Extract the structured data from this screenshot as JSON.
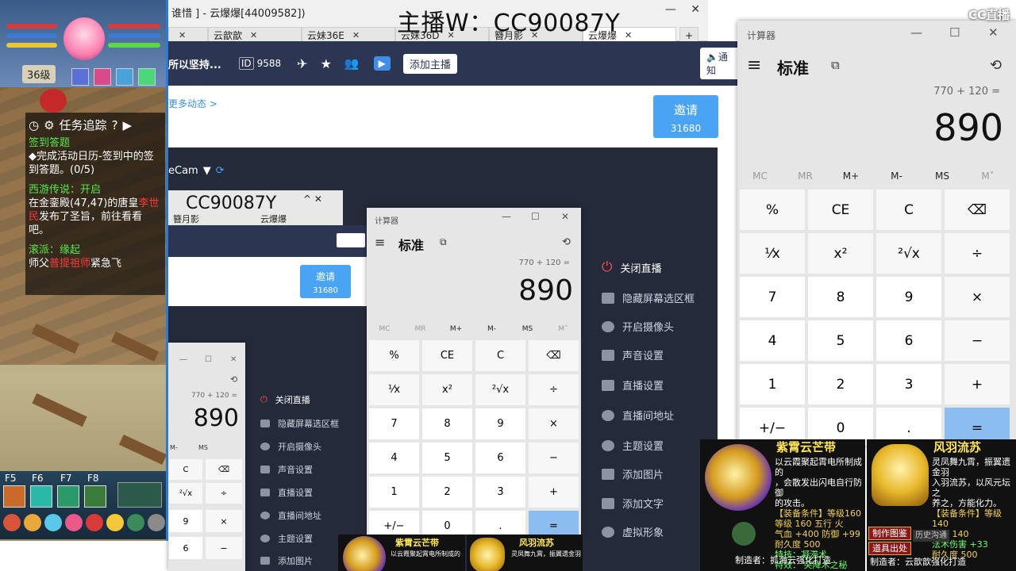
{
  "watermark": "主播W：CC90087Y",
  "cc_logo": "CC直播",
  "browser": {
    "title": "谁惜 ] - 云爆爆[44009582])",
    "tabs": [
      {
        "label": "云歆歆"
      },
      {
        "label": "云妹36E"
      },
      {
        "label": "云妹36D"
      },
      {
        "label": "簪月影"
      },
      {
        "label": "云爆爆"
      }
    ],
    "new_tab": "+"
  },
  "cc_toolbar": {
    "slogan": "所以坚持...",
    "id_label": "ID",
    "id_value": "9588",
    "add_anchor": "添加主播",
    "notify": "通知",
    "dynamic_link": "更多动态 >",
    "invite_label": "邀请",
    "invite_count": "31680",
    "source_label": "eCam"
  },
  "game": {
    "level": "36级",
    "task_tracking": "任务追踪",
    "tasks": [
      {
        "title": "签到答题",
        "body": "◆完成活动日历-签到中的签到答题。(0/5)"
      },
      {
        "title": "西游传说：开启",
        "body_a": "在金銮殿(47,47)的唐皇",
        "body_red": "李世民",
        "body_b": "发布了圣旨，前往看看吧。"
      },
      {
        "title": "滚派：缘起",
        "body_a": "师父",
        "body_red": "普提祖师",
        "body_b": "紧急飞"
      }
    ],
    "hotkeys": [
      "F5",
      "F6",
      "F7",
      "F8"
    ]
  },
  "stream_menu": [
    "关闭直播",
    "隐藏屏幕选区框",
    "开启摄像头",
    "声音设置",
    "直播设置",
    "直播间地址",
    "主题设置",
    "添加图片",
    "添加文字",
    "虚拟形象"
  ],
  "calculator": {
    "app_name": "计算器",
    "mode": "标准",
    "expression": "770 + 120 =",
    "result": "890",
    "memory": [
      "MC",
      "MR",
      "M+",
      "M-",
      "MS",
      "M˅"
    ],
    "keys": [
      [
        "%",
        "CE",
        "C",
        "⌫"
      ],
      [
        "¹⁄x",
        "x²",
        "²√x",
        "÷"
      ],
      [
        "7",
        "8",
        "9",
        "×"
      ],
      [
        "4",
        "5",
        "6",
        "−"
      ],
      [
        "1",
        "2",
        "3",
        "+"
      ],
      [
        "+/−",
        "0",
        ".",
        "="
      ]
    ]
  },
  "items": [
    {
      "name": "紫霄云芒带",
      "line1": "以云霞聚起霄电所制成的",
      "line2": "，会散发出闪电自行防御",
      "line3": "的攻击。",
      "req": "【装备条件】等级160",
      "stats_a": "等级 160  五行 火",
      "stats_b": "气血 +400 防御 +99",
      "durability": "耐久度 500",
      "special": "特技：凝滞术",
      "effect": "特效：  突降术之秘",
      "maker": "制造者：抓海云强化打造"
    },
    {
      "name": "风羽流苏",
      "line1": "灵凤舞九霄，振翼遗金羽",
      "line2": "入羽流苏，以风元坛之",
      "line3": "养之，方能化力。",
      "req": "【装备条件】等级140",
      "stats_a": "等级 140",
      "stats_b": "法术伤害 +33",
      "durability": "耐久度 500",
      "special": "历史沟通",
      "effect": "制作图鉴",
      "maker": "制造者：云歆歆强化打造"
    }
  ],
  "item_buttons": [
    "制作图鉴",
    "道具出处",
    "历史沟通"
  ]
}
